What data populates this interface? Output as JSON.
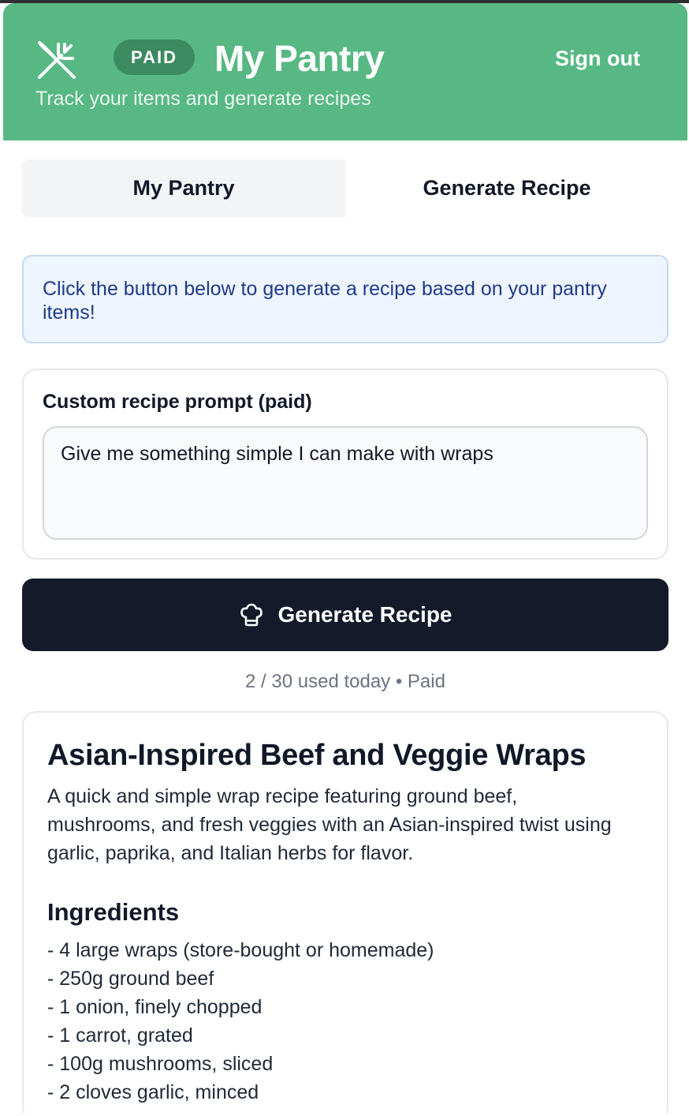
{
  "header": {
    "logo_icon": "fork-knife-crossed-icon",
    "badge": "PAID",
    "title": "My Pantry",
    "subtitle": "Track your items and generate recipes",
    "sign_out": "Sign out",
    "bg_color": "#57b884"
  },
  "tabs": [
    {
      "label": "My Pantry",
      "active": false
    },
    {
      "label": "Generate Recipe",
      "active": true
    }
  ],
  "info": {
    "text": "Click the button below to generate a recipe based on your pantry items!"
  },
  "prompt": {
    "label": "Custom recipe prompt (paid)",
    "value": "Give me something simple I can make with wraps"
  },
  "generate": {
    "label": "Generate Recipe",
    "icon": "chef-hat-icon"
  },
  "usage": {
    "count": "2 / 30 used today",
    "separator": "•",
    "plan": "Paid"
  },
  "recipe": {
    "title": "Asian-Inspired Beef and Veggie Wraps",
    "description": "A quick and simple wrap recipe featuring ground beef, mushrooms, and fresh veggies with an Asian-inspired twist using garlic, paprika, and Italian herbs for flavor.",
    "ingredients_heading": "Ingredients",
    "ingredients": [
      "- 4 large wraps (store-bought or homemade)",
      "- 250g ground beef",
      "- 1 onion, finely chopped",
      "- 1 carrot, grated",
      "- 100g mushrooms, sliced",
      "- 2 cloves garlic, minced"
    ]
  }
}
